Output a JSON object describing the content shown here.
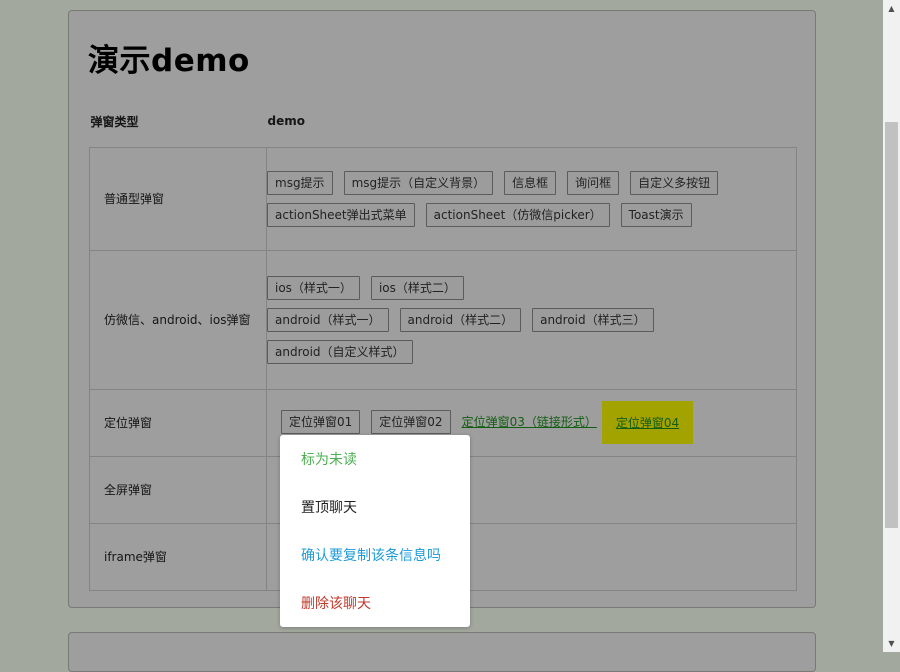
{
  "page": {
    "title": "演示demo"
  },
  "table": {
    "header": {
      "type": "弹窗类型",
      "demo": "demo"
    },
    "rows": [
      {
        "label": "普通型弹窗",
        "buttons": [
          "msg提示",
          "msg提示（自定义背景）",
          "信息框",
          "询问框",
          "自定义多按钮",
          "actionSheet弹出式菜单",
          "actionSheet（仿微信picker）",
          "Toast演示"
        ]
      },
      {
        "label": "仿微信、android、ios弹窗",
        "buttons": [
          "ios（样式一）",
          "ios（样式二）",
          "android（样式一）",
          "android（样式二）",
          "android（样式三）",
          "android（自定义样式）"
        ]
      },
      {
        "label": "定位弹窗",
        "buttons": [
          "定位弹窗01",
          "定位弹窗02"
        ],
        "links": [
          "定位弹窗03（链接形式）",
          "定位弹窗04"
        ]
      },
      {
        "label": "全屏弹窗"
      },
      {
        "label": "iframe弹窗"
      }
    ]
  },
  "popup_menu": {
    "items": [
      {
        "label": "标为未读",
        "color": "#4caf50"
      },
      {
        "label": "置顶聊天",
        "color": "#222222"
      },
      {
        "label": "确认要复制该条信息吗",
        "color": "#1e9bd7"
      },
      {
        "label": "删除该聊天",
        "color": "#c0392b"
      }
    ]
  },
  "colors": {
    "overlay": "#a3a89f",
    "link_highlight": "#f5f500"
  }
}
